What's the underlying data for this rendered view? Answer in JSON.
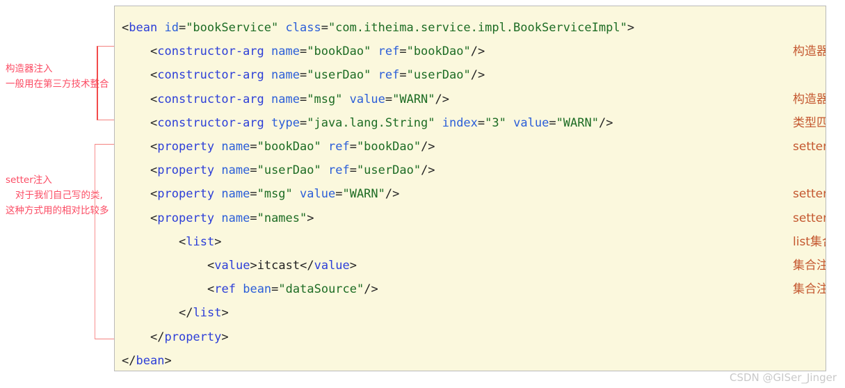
{
  "code": {
    "language": "xml",
    "lines": [
      {
        "indent": 0,
        "tokens": [
          {
            "t": "punc",
            "v": "<"
          },
          {
            "t": "tag",
            "v": "bean"
          },
          {
            "t": "punc",
            "v": " "
          },
          {
            "t": "attr",
            "v": "id"
          },
          {
            "t": "punc",
            "v": "="
          },
          {
            "t": "str",
            "v": "\"bookService\""
          },
          {
            "t": "punc",
            "v": " "
          },
          {
            "t": "attr",
            "v": "class"
          },
          {
            "t": "punc",
            "v": "="
          },
          {
            "t": "str",
            "v": "\"com.itheima.service.impl.BookServiceImpl\""
          },
          {
            "t": "punc",
            "v": ">"
          }
        ]
      },
      {
        "indent": 1,
        "tokens": [
          {
            "t": "punc",
            "v": "<"
          },
          {
            "t": "tag",
            "v": "constructor-arg"
          },
          {
            "t": "punc",
            "v": " "
          },
          {
            "t": "attr",
            "v": "name"
          },
          {
            "t": "punc",
            "v": "="
          },
          {
            "t": "str",
            "v": "\"bookDao\""
          },
          {
            "t": "punc",
            "v": " "
          },
          {
            "t": "attr",
            "v": "ref"
          },
          {
            "t": "punc",
            "v": "="
          },
          {
            "t": "str",
            "v": "\"bookDao\""
          },
          {
            "t": "punc",
            "v": "/>"
          }
        ]
      },
      {
        "indent": 1,
        "tokens": [
          {
            "t": "punc",
            "v": "<"
          },
          {
            "t": "tag",
            "v": "constructor-arg"
          },
          {
            "t": "punc",
            "v": " "
          },
          {
            "t": "attr",
            "v": "name"
          },
          {
            "t": "punc",
            "v": "="
          },
          {
            "t": "str",
            "v": "\"userDao\""
          },
          {
            "t": "punc",
            "v": " "
          },
          {
            "t": "attr",
            "v": "ref"
          },
          {
            "t": "punc",
            "v": "="
          },
          {
            "t": "str",
            "v": "\"userDao\""
          },
          {
            "t": "punc",
            "v": "/>"
          }
        ]
      },
      {
        "indent": 1,
        "tokens": [
          {
            "t": "punc",
            "v": "<"
          },
          {
            "t": "tag",
            "v": "constructor-arg"
          },
          {
            "t": "punc",
            "v": " "
          },
          {
            "t": "attr",
            "v": "name"
          },
          {
            "t": "punc",
            "v": "="
          },
          {
            "t": "str",
            "v": "\"msg\""
          },
          {
            "t": "punc",
            "v": " "
          },
          {
            "t": "attr",
            "v": "value"
          },
          {
            "t": "punc",
            "v": "="
          },
          {
            "t": "str",
            "v": "\"WARN\""
          },
          {
            "t": "punc",
            "v": "/>"
          }
        ]
      },
      {
        "indent": 1,
        "tokens": [
          {
            "t": "punc",
            "v": "<"
          },
          {
            "t": "tag",
            "v": "constructor-arg"
          },
          {
            "t": "punc",
            "v": " "
          },
          {
            "t": "attr",
            "v": "type"
          },
          {
            "t": "punc",
            "v": "="
          },
          {
            "t": "str",
            "v": "\"java.lang.String\""
          },
          {
            "t": "punc",
            "v": " "
          },
          {
            "t": "attr",
            "v": "index"
          },
          {
            "t": "punc",
            "v": "="
          },
          {
            "t": "str",
            "v": "\"3\""
          },
          {
            "t": "punc",
            "v": " "
          },
          {
            "t": "attr",
            "v": "value"
          },
          {
            "t": "punc",
            "v": "="
          },
          {
            "t": "str",
            "v": "\"WARN\""
          },
          {
            "t": "punc",
            "v": "/>"
          }
        ]
      },
      {
        "indent": 1,
        "tokens": [
          {
            "t": "punc",
            "v": "<"
          },
          {
            "t": "tag",
            "v": "property"
          },
          {
            "t": "punc",
            "v": " "
          },
          {
            "t": "attr",
            "v": "name"
          },
          {
            "t": "punc",
            "v": "="
          },
          {
            "t": "str",
            "v": "\"bookDao\""
          },
          {
            "t": "punc",
            "v": " "
          },
          {
            "t": "attr",
            "v": "ref"
          },
          {
            "t": "punc",
            "v": "="
          },
          {
            "t": "str",
            "v": "\"bookDao\""
          },
          {
            "t": "punc",
            "v": "/>"
          }
        ]
      },
      {
        "indent": 1,
        "tokens": [
          {
            "t": "punc",
            "v": "<"
          },
          {
            "t": "tag",
            "v": "property"
          },
          {
            "t": "punc",
            "v": " "
          },
          {
            "t": "attr",
            "v": "name"
          },
          {
            "t": "punc",
            "v": "="
          },
          {
            "t": "str",
            "v": "\"userDao\""
          },
          {
            "t": "punc",
            "v": " "
          },
          {
            "t": "attr",
            "v": "ref"
          },
          {
            "t": "punc",
            "v": "="
          },
          {
            "t": "str",
            "v": "\"userDao\""
          },
          {
            "t": "punc",
            "v": "/>"
          }
        ]
      },
      {
        "indent": 1,
        "tokens": [
          {
            "t": "punc",
            "v": "<"
          },
          {
            "t": "tag",
            "v": "property"
          },
          {
            "t": "punc",
            "v": " "
          },
          {
            "t": "attr",
            "v": "name"
          },
          {
            "t": "punc",
            "v": "="
          },
          {
            "t": "str",
            "v": "\"msg\""
          },
          {
            "t": "punc",
            "v": " "
          },
          {
            "t": "attr",
            "v": "value"
          },
          {
            "t": "punc",
            "v": "="
          },
          {
            "t": "str",
            "v": "\"WARN\""
          },
          {
            "t": "punc",
            "v": "/>"
          }
        ]
      },
      {
        "indent": 1,
        "tokens": [
          {
            "t": "punc",
            "v": "<"
          },
          {
            "t": "tag",
            "v": "property"
          },
          {
            "t": "punc",
            "v": " "
          },
          {
            "t": "attr",
            "v": "name"
          },
          {
            "t": "punc",
            "v": "="
          },
          {
            "t": "str",
            "v": "\"names\""
          },
          {
            "t": "punc",
            "v": ">"
          }
        ]
      },
      {
        "indent": 2,
        "tokens": [
          {
            "t": "punc",
            "v": "<"
          },
          {
            "t": "tag",
            "v": "list"
          },
          {
            "t": "punc",
            "v": ">"
          }
        ]
      },
      {
        "indent": 3,
        "tokens": [
          {
            "t": "punc",
            "v": "<"
          },
          {
            "t": "tag",
            "v": "value"
          },
          {
            "t": "punc",
            "v": ">"
          },
          {
            "t": "txt",
            "v": "itcast"
          },
          {
            "t": "punc",
            "v": "</"
          },
          {
            "t": "tag",
            "v": "value"
          },
          {
            "t": "punc",
            "v": ">"
          }
        ]
      },
      {
        "indent": 3,
        "tokens": [
          {
            "t": "punc",
            "v": "<"
          },
          {
            "t": "tag",
            "v": "ref"
          },
          {
            "t": "punc",
            "v": " "
          },
          {
            "t": "attr",
            "v": "bean"
          },
          {
            "t": "punc",
            "v": "="
          },
          {
            "t": "str",
            "v": "\"dataSource\""
          },
          {
            "t": "punc",
            "v": "/>"
          }
        ]
      },
      {
        "indent": 2,
        "tokens": [
          {
            "t": "punc",
            "v": "</"
          },
          {
            "t": "tag",
            "v": "list"
          },
          {
            "t": "punc",
            "v": ">"
          }
        ]
      },
      {
        "indent": 1,
        "tokens": [
          {
            "t": "punc",
            "v": "</"
          },
          {
            "t": "tag",
            "v": "property"
          },
          {
            "t": "punc",
            "v": ">"
          }
        ]
      },
      {
        "indent": 0,
        "tokens": [
          {
            "t": "punc",
            "v": "</"
          },
          {
            "t": "tag",
            "v": "bean"
          },
          {
            "t": "punc",
            "v": ">"
          }
        ]
      }
    ]
  },
  "right_annotations": [
    {
      "line": 1,
      "text": "构造器注入引用类型"
    },
    {
      "line": 3,
      "text": "构造器注入简单类型"
    },
    {
      "line": 4,
      "text": "类型匹配与索引匹配"
    },
    {
      "line": 5,
      "text": "setter注入引用类型"
    },
    {
      "line": 7,
      "text": "setter注入简单类型"
    },
    {
      "line": 8,
      "text": "setter注入集合类型"
    },
    {
      "line": 9,
      "text": "list集合"
    },
    {
      "line": 10,
      "text": "集合注入简单类型"
    },
    {
      "line": 11,
      "text": "集合注入引用类型"
    }
  ],
  "left_annotations": [
    {
      "id": "constructor-injection",
      "lines": [
        "构造器注入",
        "一般用在第三方技术整合"
      ]
    },
    {
      "id": "setter-injection",
      "lines": [
        "setter注入",
        "对于我们自己写的类,",
        "这种方式用的相对比较多"
      ]
    }
  ],
  "watermark": {
    "text": "CSDN @GISer_Jinger"
  },
  "colors": {
    "panel_bg": "#fbf8dd",
    "panel_border": "#b9b9b9",
    "tag": "#2c3ed8",
    "attr": "#2b5ed8",
    "string": "#1d6c24",
    "punctuation": "#222222",
    "right_annotation": "#c4572f",
    "left_annotation": "#fb4b63",
    "bracket": "#f24a4a",
    "watermark": "#c9c9c9"
  }
}
